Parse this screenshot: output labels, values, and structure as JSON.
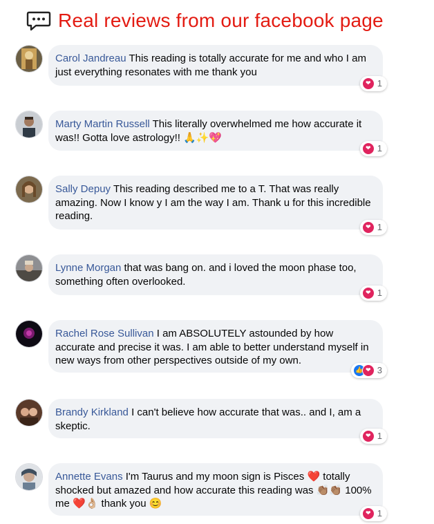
{
  "header": {
    "title": "Real reviews from our facebook page",
    "icon": "chat-bubble-icon",
    "title_color": "#e31b12"
  },
  "colors": {
    "name": "#385898",
    "bubble": "#f0f2f5",
    "heart": "#e0245e",
    "like": "#1877f2"
  },
  "reviews": [
    {
      "name": "Carol Jandreau",
      "text": "This reading is totally accurate for me and who I am just everything resonates with me thank you",
      "reactions": [
        "heart"
      ],
      "count": "1"
    },
    {
      "name": "Marty Martin Russell",
      "text": "This literally overwhelmed me how accurate it was!! Gotta love astrology!! 🙏✨💖",
      "reactions": [
        "heart"
      ],
      "count": "1"
    },
    {
      "name": "Sally Depuy",
      "text": "This reading described me to a T. That was really amazing. Now I know y I am the way I am. Thank u for this incredible reading.",
      "reactions": [
        "heart"
      ],
      "count": "1"
    },
    {
      "name": "Lynne Morgan",
      "text": "that was bang on. and i loved the moon phase too, something often overlooked.",
      "reactions": [
        "heart"
      ],
      "count": "1"
    },
    {
      "name": "Rachel Rose Sullivan",
      "text": "I am ABSOLUTELY astounded by how accurate and precise it was. I am able to better understand myself in new ways from other perspectives outside of my own.",
      "reactions": [
        "like",
        "heart"
      ],
      "count": "3"
    },
    {
      "name": "Brandy Kirkland",
      "text": "I can't believe how accurate that was.. and I, am a skeptic.",
      "reactions": [
        "heart"
      ],
      "count": "1"
    },
    {
      "name": "Annette Evans",
      "text": "I'm Taurus and my moon sign is Pisces ❤️ totally shocked but amazed and how accurate this reading was 👏🏽👏🏽 100% me ❤️👌🏼 thank you 😊",
      "reactions": [
        "heart"
      ],
      "count": "1"
    }
  ]
}
